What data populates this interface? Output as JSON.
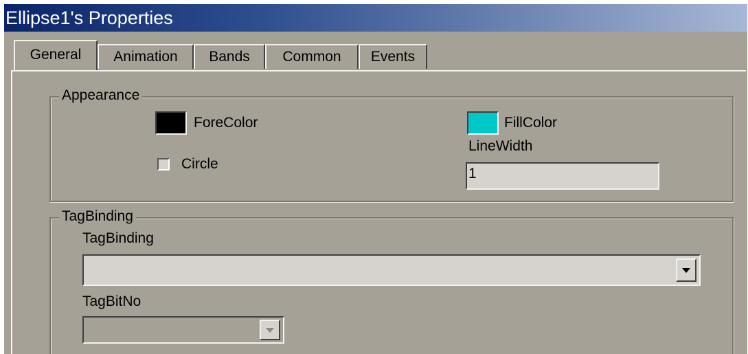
{
  "window": {
    "title": "Ellipse1's Properties"
  },
  "tabs": [
    {
      "label": "General",
      "active": true
    },
    {
      "label": "Animation",
      "active": false
    },
    {
      "label": "Bands",
      "active": false
    },
    {
      "label": "Common",
      "active": false
    },
    {
      "label": "Events",
      "active": false
    }
  ],
  "appearance": {
    "legend": "Appearance",
    "forecolor_label": "ForeColor",
    "forecolor_value": "#000000",
    "fillcolor_label": "FillColor",
    "fillcolor_value": "#00c8c8",
    "circle_label": "Circle",
    "circle_checked": false,
    "linewidth_label": "LineWidth",
    "linewidth_value": "1"
  },
  "tagbinding": {
    "legend": "TagBinding",
    "tagbinding_label": "TagBinding",
    "tagbinding_value": "",
    "tagbitno_label": "TagBitNo",
    "tagbitno_value": ""
  },
  "colors": {
    "dialog_bg": "#a6a197",
    "title_bar_start": "#0a246a",
    "title_bar_end": "#a6b8d6",
    "title_text": "#ffffff"
  }
}
